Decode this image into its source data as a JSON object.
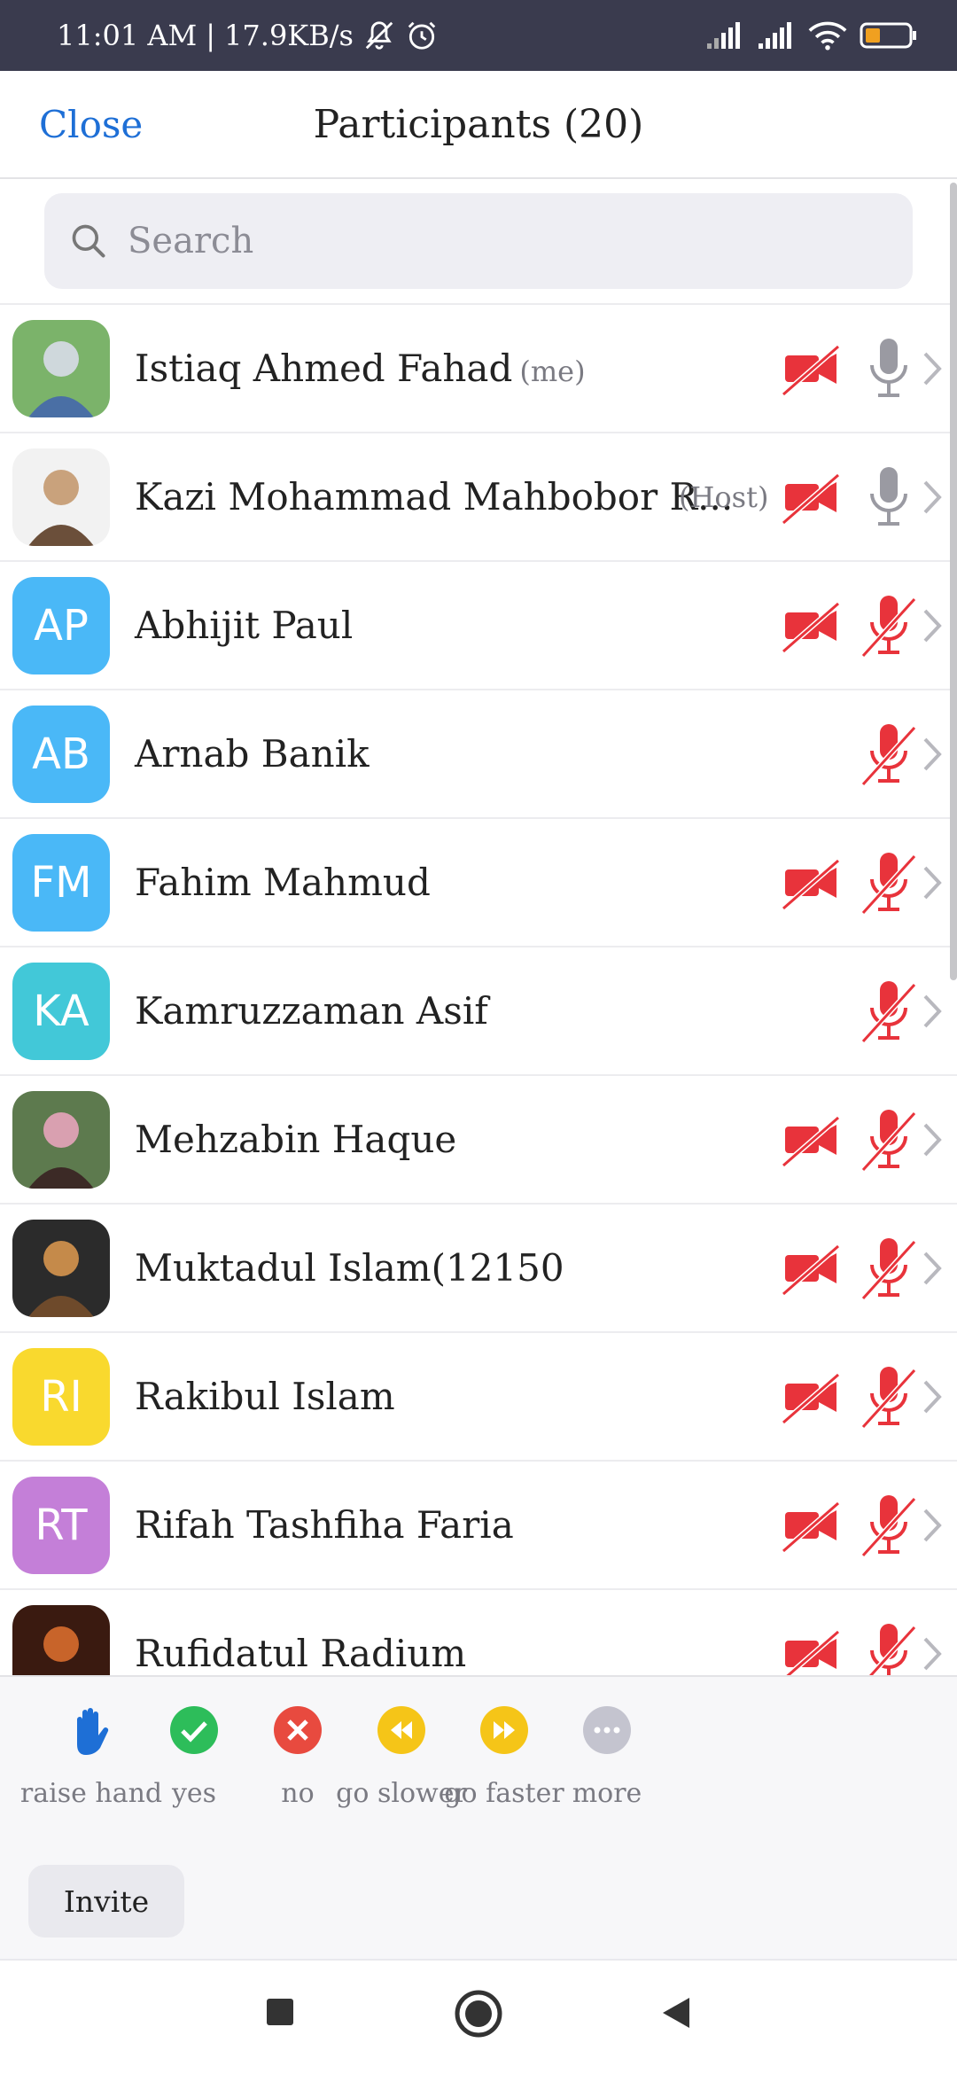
{
  "status_bar": {
    "time": "11:01 AM",
    "separator": "|",
    "speed": "17.9KB/s",
    "icons": [
      "bell-off-icon",
      "alarm-icon",
      "signal-icon",
      "signal-icon",
      "wifi-icon",
      "battery-icon"
    ],
    "battery_color": "#f0a020"
  },
  "header": {
    "close_label": "Close",
    "title": "Participants (20)"
  },
  "search": {
    "placeholder": "Search"
  },
  "participants": [
    {
      "name": "Istiaq Ahmed Fahad",
      "tag": "(me)",
      "avatar": "photo",
      "video": "off",
      "mic": "on"
    },
    {
      "name": "Kazi Mohammad Mahbobor R...",
      "tag": "(Host)",
      "avatar": "photo",
      "video": "off",
      "mic": "on"
    },
    {
      "name": "Abhijit Paul",
      "initials": "AP",
      "avatar_color": "#4ab8f7",
      "video": "off",
      "mic": "muted"
    },
    {
      "name": "Arnab Banik",
      "initials": "AB",
      "avatar_color": "#4ab8f7",
      "video": "none",
      "mic": "muted"
    },
    {
      "name": "Fahim Mahmud",
      "initials": "FM",
      "avatar_color": "#4ab8f7",
      "video": "off",
      "mic": "muted"
    },
    {
      "name": "Kamruzzaman Asif",
      "initials": "KA",
      "avatar_color": "#42c8d8",
      "video": "none",
      "mic": "muted"
    },
    {
      "name": "Mehzabin Haque",
      "avatar": "photo",
      "video": "off",
      "mic": "muted"
    },
    {
      "name": "Muktadul Islam(12150",
      "avatar": "photo",
      "video": "off",
      "mic": "muted"
    },
    {
      "name": "Rakibul Islam",
      "initials": "RI",
      "avatar_color": "#f9d92e",
      "video": "off",
      "mic": "muted"
    },
    {
      "name": "Rifah Tashfiha Faria",
      "initials": "RT",
      "avatar_color": "#c47fd8",
      "video": "off",
      "mic": "muted"
    },
    {
      "name": "Rufidatul Radium",
      "avatar": "photo",
      "video": "off",
      "mic": "muted"
    }
  ],
  "reactions": [
    {
      "label": "raise hand",
      "icon": "raise-hand-icon",
      "color": "#1e6fd6"
    },
    {
      "label": "yes",
      "icon": "check-icon",
      "color": "#2dbd5a"
    },
    {
      "label": "no",
      "icon": "x-icon",
      "color": "#e84a3f"
    },
    {
      "label": "go slower",
      "icon": "rewind-icon",
      "color": "#f5c518"
    },
    {
      "label": "go faster",
      "icon": "fast-forward-icon",
      "color": "#f5c518"
    },
    {
      "label": "more",
      "icon": "more-icon",
      "color": "#c4c4cf"
    }
  ],
  "invite_label": "Invite",
  "colors": {
    "accent": "#1e6fd6",
    "muted_red": "#e8333b",
    "status_bar": "#3a3b4e"
  }
}
